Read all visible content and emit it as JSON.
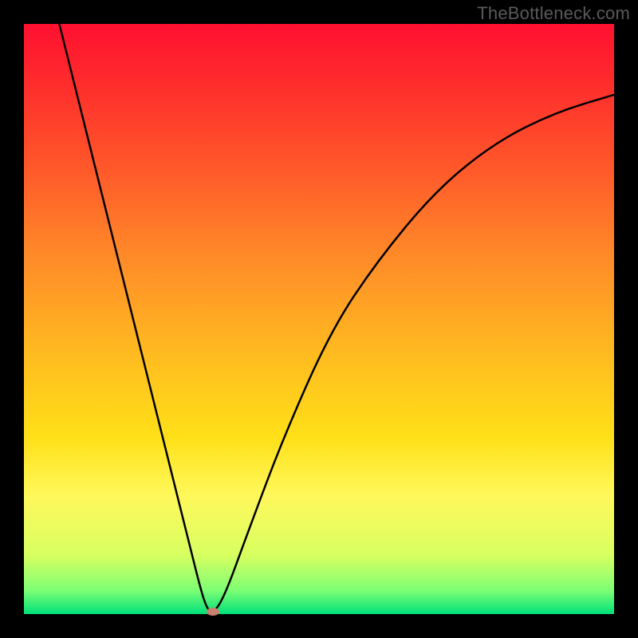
{
  "watermark": "TheBottleneck.com",
  "chart_data": {
    "type": "line",
    "title": "",
    "xlabel": "",
    "ylabel": "",
    "xlim": [
      0,
      100
    ],
    "ylim": [
      0,
      100
    ],
    "grid": false,
    "legend": false,
    "annotations": [],
    "series": [
      {
        "name": "curve",
        "x": [
          6,
          10,
          14,
          18,
          22,
          26,
          28,
          30,
          31,
          32,
          34,
          38,
          44,
          52,
          60,
          70,
          80,
          90,
          100
        ],
        "values": [
          100,
          84,
          68,
          52,
          36,
          20,
          12,
          4,
          1,
          0,
          3,
          14,
          30,
          48,
          60,
          72,
          80,
          85,
          88
        ]
      }
    ],
    "vertex": {
      "x": 32,
      "y": 0
    },
    "gradient_stops": [
      {
        "pos": 0,
        "color": "#ff1030"
      },
      {
        "pos": 40,
        "color": "#ff8c28"
      },
      {
        "pos": 70,
        "color": "#ffe018"
      },
      {
        "pos": 100,
        "color": "#00e07a"
      }
    ]
  }
}
